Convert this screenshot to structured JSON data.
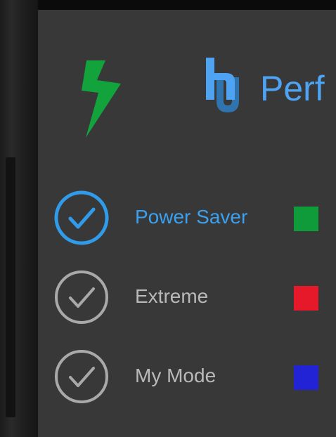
{
  "app": {
    "title": "Perf"
  },
  "icons": {
    "bolt": "lightning-bolt",
    "logo": "brand-logo"
  },
  "modes": [
    {
      "label": "Power Saver",
      "selected": true,
      "label_color": "#3aa0f0",
      "check_color": "#2f9be9",
      "swatch_color": "#0f9b3a"
    },
    {
      "label": "Extreme",
      "selected": false,
      "label_color": "#b9b9b9",
      "check_color": "#a9a9a9",
      "swatch_color": "#e5192a"
    },
    {
      "label": "My Mode",
      "selected": false,
      "label_color": "#b9b9b9",
      "check_color": "#a9a9a9",
      "swatch_color": "#2323d6"
    }
  ],
  "colors": {
    "screen_bg": "#383838",
    "accent": "#4ea3f2",
    "bolt_green": "#12a33c"
  }
}
